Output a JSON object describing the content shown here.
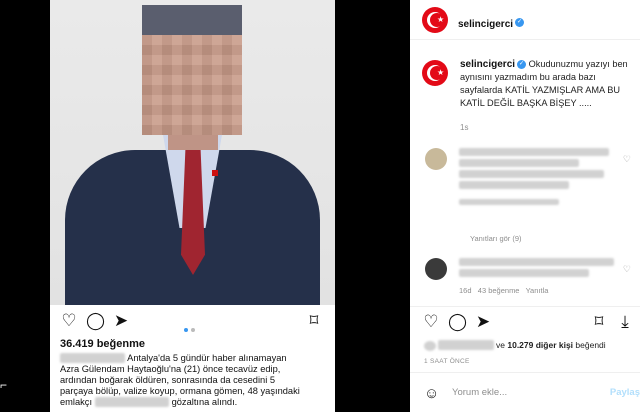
{
  "post": {
    "likes": "36.419 beğenme",
    "caption_prefix": "Antalya'da 5 gündür haber alınamayan",
    "caption_line2": "Azra Gülendam Haytaoğlu'na (21) önce tecavüz edip,",
    "caption_line3": "ardından boğarak öldüren, sonrasında da cesedini 5",
    "caption_line4": "parçaya bölüp, valize koyup, ormana gömen, 48 yaşındaki",
    "caption_line5_a": "emlakçı",
    "caption_line5_b": "gözaltına alındı."
  },
  "panel": {
    "header_username": "selincigerci",
    "owner_username": "selincigerci",
    "owner_text": "Okudunuzmu yazıyı ben aynısını yazmadım bu arada bazı sayfalarda KATİL YAZMIŞLAR AMA BU KATİL DEĞİL BAŞKA BİŞEY .....",
    "owner_time": "1s",
    "comments": [
      {
        "meta": "Yanıtları gör (9)"
      },
      {
        "meta_time": "16d",
        "meta_likes": "43 beğenme",
        "meta_reply": "Yanıtla"
      }
    ],
    "liked_by_mid": "ve",
    "liked_count": "10.279 diğer kişi",
    "liked_suffix": "beğendi",
    "ago": "1 SAAT ÖNCE",
    "comment_placeholder": "Yorum ekle...",
    "post_button": "Paylaş"
  },
  "icons": {
    "heart": "heart-icon",
    "comment": "comment-icon",
    "share": "share-icon",
    "save": "save-icon",
    "download": "download-icon",
    "emoji": "emoji-icon"
  },
  "colors": {
    "verified": "#3897f0",
    "flag_red": "#e30a17",
    "link_disabled": "#b2dffc"
  }
}
